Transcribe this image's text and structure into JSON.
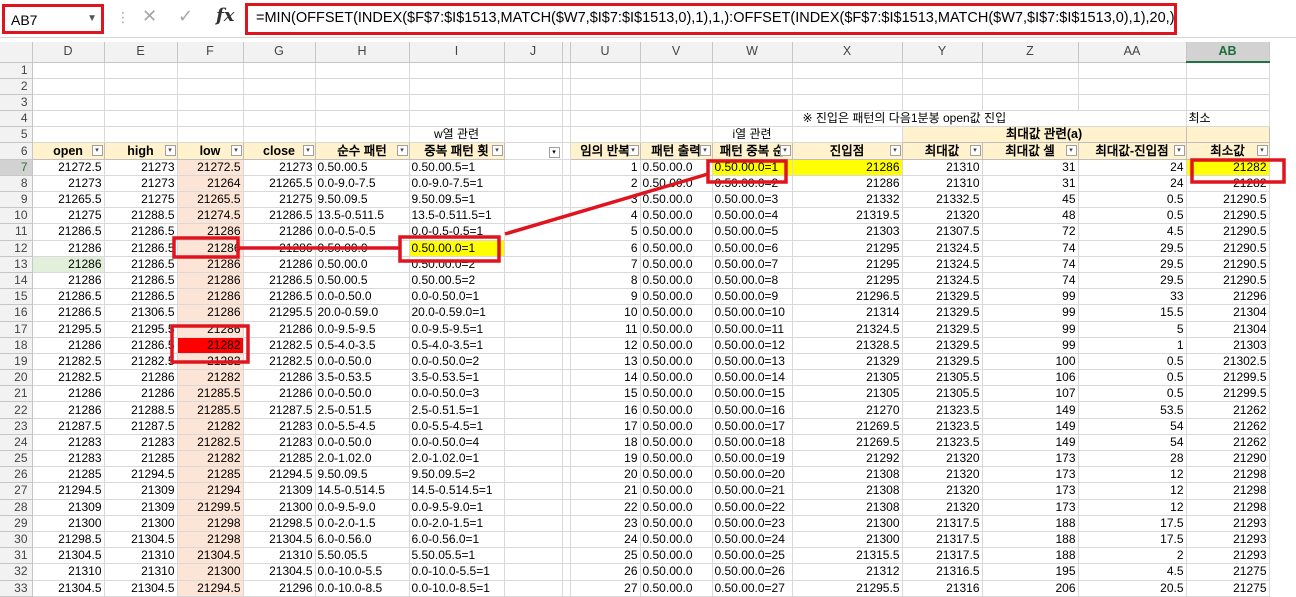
{
  "formula_bar": {
    "name_box": "AB7",
    "formula": "=MIN(OFFSET(INDEX($F$7:$I$1513,MATCH($W7,$I$7:$I$1513,0),1),1,):OFFSET(INDEX($F$7:$I$1513,MATCH($W7,$I$7:$I$1513,0),1),20,))",
    "cancel_symbol": "✕",
    "enter_symbol": "✓",
    "fx_symbol": "fx",
    "sep_symbol": "⋮"
  },
  "columns": [
    "D",
    "E",
    "F",
    "G",
    "H",
    "I",
    "J",
    "",
    "U",
    "V",
    "W",
    "X",
    "Y",
    "Z",
    "AA",
    "AB"
  ],
  "selected_column": "AB",
  "selected_row": "7",
  "row_numbers": [
    "1",
    "2",
    "3",
    "4",
    "5",
    "6",
    "7",
    "8",
    "9",
    "10",
    "11",
    "12",
    "13",
    "14",
    "15",
    "16",
    "17",
    "18",
    "19",
    "20",
    "21",
    "22",
    "23",
    "24",
    "25",
    "26",
    "27",
    "28",
    "29",
    "30",
    "31",
    "32",
    "33"
  ],
  "notes": {
    "row4_x": "※ 진입은 패턴의 다음1분봉 open값 진입",
    "row4_ab": "최소",
    "row5_i": "w열 관련",
    "row5_w": "i열 관련",
    "row5_za": "최대값 관련(a)"
  },
  "headers": {
    "open": "open",
    "high": "high",
    "low": "low",
    "close": "close",
    "pure_pattern": "순수 패턴",
    "dup_pattern": "중복 패턴 횟",
    "u": "임의 반복",
    "v": "패턴 출력",
    "w": "패턴 중복 순",
    "x": "진입점",
    "y": "최대값",
    "z": "최대값 셀",
    "aa": "최대값-진입점",
    "ab": "최소값"
  },
  "rows": [
    [
      "21272.5",
      "21273",
      "21272.5",
      "21273",
      "0.50.00.5",
      "0.50.00.5=1",
      "1",
      "0.50.00.0",
      "0.50.00.0=1",
      "21286",
      "21310",
      "31",
      "24",
      "21282"
    ],
    [
      "21273",
      "21273",
      "21264",
      "21265.5",
      "0.0-9.0-7.5",
      "0.0-9.0-7.5=1",
      "2",
      "0.50.00.0",
      "0.50.00.0=2",
      "21286",
      "21310",
      "31",
      "24",
      "21282"
    ],
    [
      "21265.5",
      "21275",
      "21265.5",
      "21275",
      "9.50.09.5",
      "9.50.09.5=1",
      "3",
      "0.50.00.0",
      "0.50.00.0=3",
      "21332",
      "21332.5",
      "45",
      "0.5",
      "21290.5"
    ],
    [
      "21275",
      "21288.5",
      "21274.5",
      "21286.5",
      "13.5-0.511.5",
      "13.5-0.511.5=1",
      "4",
      "0.50.00.0",
      "0.50.00.0=4",
      "21319.5",
      "21320",
      "48",
      "0.5",
      "21290.5"
    ],
    [
      "21286.5",
      "21286.5",
      "21286",
      "21286",
      "0.0-0.5-0.5",
      "0.0-0.5-0.5=1",
      "5",
      "0.50.00.0",
      "0.50.00.0=5",
      "21303",
      "21307.5",
      "72",
      "4.5",
      "21290.5"
    ],
    [
      "21286",
      "21286.5",
      "21286",
      "21286",
      "0.50.00.0",
      "0.50.00.0=1",
      "6",
      "0.50.00.0",
      "0.50.00.0=6",
      "21295",
      "21324.5",
      "74",
      "29.5",
      "21290.5"
    ],
    [
      "21286",
      "21286.5",
      "21286",
      "21286",
      "0.50.00.0",
      "0.50.00.0=2",
      "7",
      "0.50.00.0",
      "0.50.00.0=7",
      "21295",
      "21324.5",
      "74",
      "29.5",
      "21290.5"
    ],
    [
      "21286",
      "21286.5",
      "21286",
      "21286.5",
      "0.50.00.5",
      "0.50.00.5=2",
      "8",
      "0.50.00.0",
      "0.50.00.0=8",
      "21295",
      "21324.5",
      "74",
      "29.5",
      "21290.5"
    ],
    [
      "21286.5",
      "21286.5",
      "21286",
      "21286.5",
      "0.0-0.50.0",
      "0.0-0.50.0=1",
      "9",
      "0.50.00.0",
      "0.50.00.0=9",
      "21296.5",
      "21329.5",
      "99",
      "33",
      "21296"
    ],
    [
      "21286.5",
      "21306.5",
      "21286",
      "21295.5",
      "20.0-0.59.0",
      "20.0-0.59.0=1",
      "10",
      "0.50.00.0",
      "0.50.00.0=10",
      "21314",
      "21329.5",
      "99",
      "15.5",
      "21304"
    ],
    [
      "21295.5",
      "21295.5",
      "21286",
      "21286",
      "0.0-9.5-9.5",
      "0.0-9.5-9.5=1",
      "11",
      "0.50.00.0",
      "0.50.00.0=11",
      "21324.5",
      "21329.5",
      "99",
      "5",
      "21304"
    ],
    [
      "21286",
      "21286.5",
      "21282",
      "21282.5",
      "0.5-4.0-3.5",
      "0.5-4.0-3.5=1",
      "12",
      "0.50.00.0",
      "0.50.00.0=12",
      "21328.5",
      "21329.5",
      "99",
      "1",
      "21303"
    ],
    [
      "21282.5",
      "21282.5",
      "21282",
      "21282.5",
      "0.0-0.50.0",
      "0.0-0.50.0=2",
      "13",
      "0.50.00.0",
      "0.50.00.0=13",
      "21329",
      "21329.5",
      "100",
      "0.5",
      "21302.5"
    ],
    [
      "21282.5",
      "21286",
      "21282",
      "21286",
      "3.5-0.53.5",
      "3.5-0.53.5=1",
      "14",
      "0.50.00.0",
      "0.50.00.0=14",
      "21305",
      "21305.5",
      "106",
      "0.5",
      "21299.5"
    ],
    [
      "21286",
      "21286",
      "21285.5",
      "21286",
      "0.0-0.50.0",
      "0.0-0.50.0=3",
      "15",
      "0.50.00.0",
      "0.50.00.0=15",
      "21305",
      "21305.5",
      "107",
      "0.5",
      "21299.5"
    ],
    [
      "21286",
      "21288.5",
      "21285.5",
      "21287.5",
      "2.5-0.51.5",
      "2.5-0.51.5=1",
      "16",
      "0.50.00.0",
      "0.50.00.0=16",
      "21270",
      "21323.5",
      "149",
      "53.5",
      "21262"
    ],
    [
      "21287.5",
      "21287.5",
      "21282",
      "21283",
      "0.0-5.5-4.5",
      "0.0-5.5-4.5=1",
      "17",
      "0.50.00.0",
      "0.50.00.0=17",
      "21269.5",
      "21323.5",
      "149",
      "54",
      "21262"
    ],
    [
      "21283",
      "21283",
      "21282.5",
      "21283",
      "0.0-0.50.0",
      "0.0-0.50.0=4",
      "18",
      "0.50.00.0",
      "0.50.00.0=18",
      "21269.5",
      "21323.5",
      "149",
      "54",
      "21262"
    ],
    [
      "21283",
      "21285",
      "21282",
      "21285",
      "2.0-1.02.0",
      "2.0-1.02.0=1",
      "19",
      "0.50.00.0",
      "0.50.00.0=19",
      "21292",
      "21320",
      "173",
      "28",
      "21290"
    ],
    [
      "21285",
      "21294.5",
      "21285",
      "21294.5",
      "9.50.09.5",
      "9.50.09.5=2",
      "20",
      "0.50.00.0",
      "0.50.00.0=20",
      "21308",
      "21320",
      "173",
      "12",
      "21298"
    ],
    [
      "21294.5",
      "21309",
      "21294",
      "21309",
      "14.5-0.514.5",
      "14.5-0.514.5=1",
      "21",
      "0.50.00.0",
      "0.50.00.0=21",
      "21308",
      "21320",
      "173",
      "12",
      "21298"
    ],
    [
      "21309",
      "21309",
      "21299.5",
      "21300",
      "0.0-9.5-9.0",
      "0.0-9.5-9.0=1",
      "22",
      "0.50.00.0",
      "0.50.00.0=22",
      "21308",
      "21320",
      "173",
      "12",
      "21298"
    ],
    [
      "21300",
      "21300",
      "21298",
      "21298.5",
      "0.0-2.0-1.5",
      "0.0-2.0-1.5=1",
      "23",
      "0.50.00.0",
      "0.50.00.0=23",
      "21300",
      "21317.5",
      "188",
      "17.5",
      "21293"
    ],
    [
      "21298.5",
      "21304.5",
      "21298",
      "21304.5",
      "6.0-0.56.0",
      "6.0-0.56.0=1",
      "24",
      "0.50.00.0",
      "0.50.00.0=24",
      "21300",
      "21317.5",
      "188",
      "17.5",
      "21293"
    ],
    [
      "21304.5",
      "21310",
      "21304.5",
      "21310",
      "5.50.05.5",
      "5.50.05.5=1",
      "25",
      "0.50.00.0",
      "0.50.00.0=25",
      "21315.5",
      "21317.5",
      "188",
      "2",
      "21293"
    ],
    [
      "21310",
      "21310",
      "21300",
      "21304.5",
      "0.0-10.0-5.5",
      "0.0-10.0-5.5=1",
      "26",
      "0.50.00.0",
      "0.50.00.0=26",
      "21312",
      "21316.5",
      "195",
      "4.5",
      "21275"
    ],
    [
      "21304.5",
      "21304.5",
      "21294.5",
      "21296",
      "0.0-10.0-8.5",
      "0.0-10.0-8.5=1",
      "27",
      "0.50.00.0",
      "0.50.00.0=27",
      "21295.5",
      "21316",
      "206",
      "20.5",
      "21275"
    ]
  ]
}
